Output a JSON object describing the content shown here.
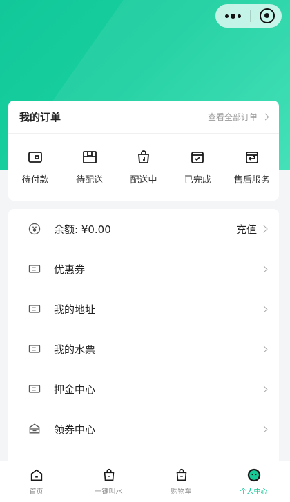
{
  "order": {
    "title": "我的订单",
    "view_all": "查看全部订单",
    "items": [
      {
        "label": "待付款",
        "icon": "wallet-icon"
      },
      {
        "label": "待配送",
        "icon": "box-icon"
      },
      {
        "label": "配送中",
        "icon": "bag-icon"
      },
      {
        "label": "已完成",
        "icon": "bag-check-icon"
      },
      {
        "label": "售后服务",
        "icon": "return-icon"
      }
    ]
  },
  "menu": {
    "balance_label": "余额: ¥0.00",
    "balance_action": "充值",
    "items": [
      {
        "label": "优惠券",
        "icon": "ticket-icon"
      },
      {
        "label": "我的地址",
        "icon": "ticket-icon"
      },
      {
        "label": "我的水票",
        "icon": "ticket-icon"
      },
      {
        "label": "押金中心",
        "icon": "ticket-icon"
      },
      {
        "label": "领券中心",
        "icon": "coupon-envelope-icon"
      }
    ]
  },
  "tabbar": {
    "items": [
      {
        "label": "首页",
        "icon": "home-icon",
        "active": false
      },
      {
        "label": "一键叫水",
        "icon": "bag-icon",
        "active": false
      },
      {
        "label": "购物车",
        "icon": "cart-bag-icon",
        "active": false
      },
      {
        "label": "个人中心",
        "icon": "profile-icon",
        "active": true
      }
    ]
  },
  "colors": {
    "accent": "#16c997",
    "icon_dark": "#1a1a1a"
  }
}
